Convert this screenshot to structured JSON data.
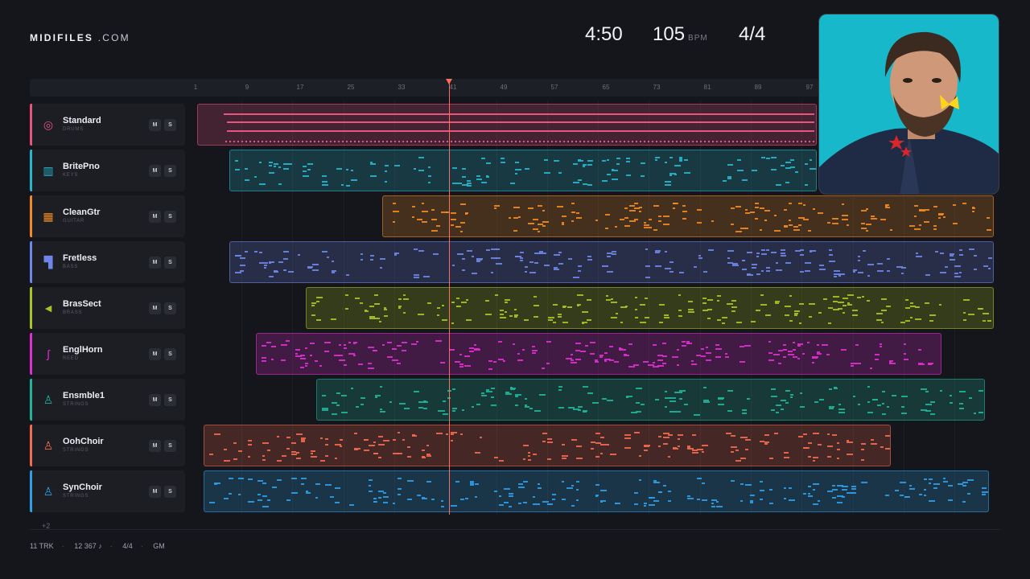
{
  "brand": {
    "name": "MIDIFILES",
    "suffix": ".COM"
  },
  "header": {
    "time": "4:50",
    "bpm": "105",
    "bpm_unit": "BPM",
    "signature": "4/4"
  },
  "ruler": {
    "ticks": [
      "1",
      "9",
      "17",
      "25",
      "33",
      "41",
      "49",
      "57",
      "65",
      "73",
      "81",
      "89",
      "97"
    ]
  },
  "tracks": [
    {
      "name": "Standard",
      "category": "DRUMS",
      "icon": "drum-icon",
      "color": "#e8547e",
      "mute_label": "M",
      "solo_label": "S"
    },
    {
      "name": "BritePno",
      "category": "KEYS",
      "icon": "piano-icon",
      "color": "#26b6cc",
      "mute_label": "M",
      "solo_label": "S"
    },
    {
      "name": "CleanGtr",
      "category": "GUITAR",
      "icon": "guitar-icon",
      "color": "#f08a24",
      "mute_label": "M",
      "solo_label": "S"
    },
    {
      "name": "Fretless",
      "category": "BASS",
      "icon": "bass-icon",
      "color": "#6f86e8",
      "mute_label": "M",
      "solo_label": "S"
    },
    {
      "name": "BrasSect",
      "category": "BRASS",
      "icon": "horn-icon",
      "color": "#a7c421",
      "mute_label": "M",
      "solo_label": "S"
    },
    {
      "name": "EnglHorn",
      "category": "REED",
      "icon": "saxophone-icon",
      "color": "#de2fd2",
      "mute_label": "M",
      "solo_label": "S"
    },
    {
      "name": "Ensmble1",
      "category": "STRINGS",
      "icon": "violin-icon",
      "color": "#1fb59a",
      "mute_label": "M",
      "solo_label": "S"
    },
    {
      "name": "OohChoir",
      "category": "STRINGS",
      "icon": "violin-icon",
      "color": "#f26a4f",
      "mute_label": "M",
      "solo_label": "S"
    },
    {
      "name": "SynChoir",
      "category": "STRINGS",
      "icon": "violin-icon",
      "color": "#2f9fe6",
      "mute_label": "M",
      "solo_label": "S"
    }
  ],
  "more_tracks": "+2",
  "footer": {
    "tracks": "11 TRK",
    "notes": "12 367 ♪",
    "signature": "4/4",
    "standard": "GM"
  },
  "photo": {
    "background": "#16b8c9",
    "subject": "portrait-photo"
  }
}
